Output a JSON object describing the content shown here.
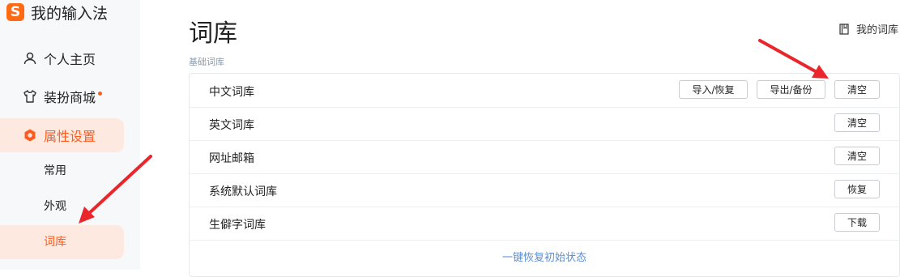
{
  "app": {
    "brand": "我的输入法",
    "logo_letter": "S",
    "brand_color": "#ff6a13"
  },
  "sidebar": {
    "items": [
      {
        "label": "个人主页",
        "icon": "user-icon"
      },
      {
        "label": "装扮商城",
        "icon": "tshirt-icon",
        "has_dot": true
      },
      {
        "label": "属性设置",
        "icon": "settings-hex-icon",
        "active": true
      }
    ],
    "sub_items": [
      {
        "label": "常用"
      },
      {
        "label": "外观"
      },
      {
        "label": "词库",
        "active": true
      }
    ],
    "accent_color": "#ff5a1f"
  },
  "main": {
    "title": "词库",
    "my_dict_link": "我的词库",
    "my_dict_icon": "book-icon",
    "section_label": "基础词库",
    "rows": [
      {
        "label": "中文词库",
        "buttons": [
          "导入/恢复",
          "导出/备份",
          "清空"
        ]
      },
      {
        "label": "英文词库",
        "buttons": [
          "清空"
        ]
      },
      {
        "label": "网址邮箱",
        "buttons": [
          "清空"
        ]
      },
      {
        "label": "系统默认词库",
        "buttons": [
          "恢复"
        ]
      },
      {
        "label": "生僻字词库",
        "buttons": [
          "下载"
        ]
      }
    ],
    "reset_all": "一键恢复初始状态"
  },
  "annotation_color": "#e8262b"
}
